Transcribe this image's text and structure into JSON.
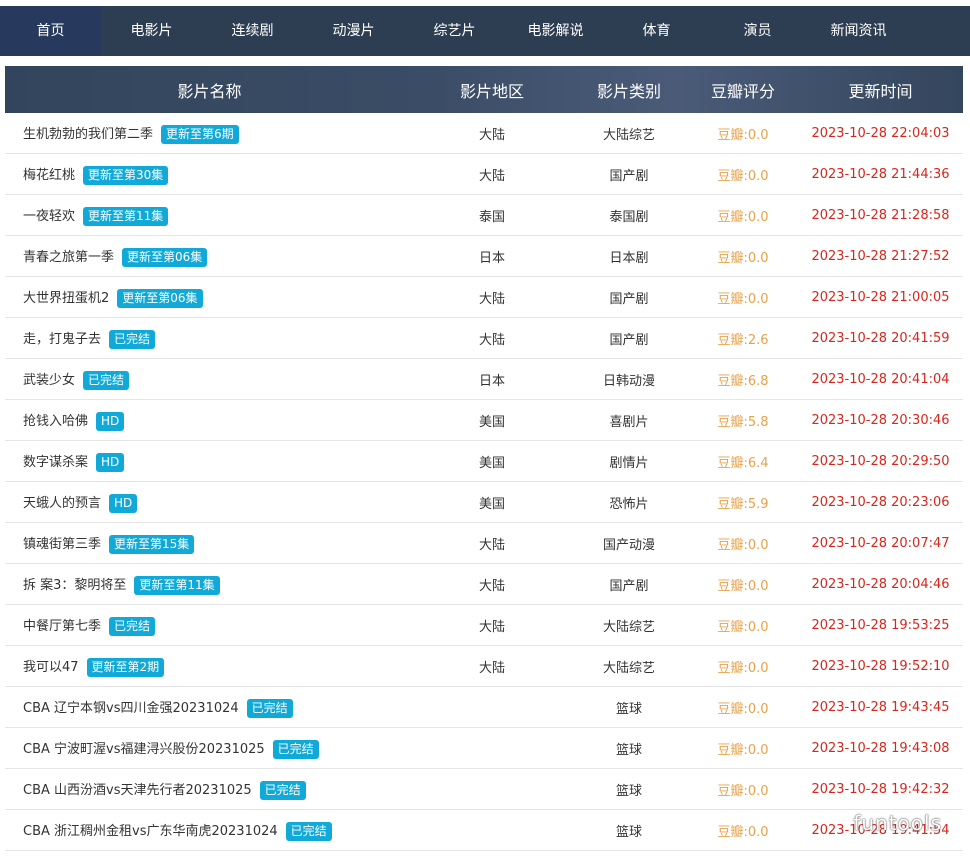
{
  "nav": [
    {
      "label": "首页",
      "active": true
    },
    {
      "label": "电影片"
    },
    {
      "label": "连续剧"
    },
    {
      "label": "动漫片"
    },
    {
      "label": "综艺片"
    },
    {
      "label": "电影解说"
    },
    {
      "label": "体育"
    },
    {
      "label": "演员"
    },
    {
      "label": "新闻资讯"
    }
  ],
  "table": {
    "headers": {
      "name": "影片名称",
      "region": "影片地区",
      "type": "影片类别",
      "score": "豆瓣评分",
      "time": "更新时间"
    },
    "rows": [
      {
        "title": "生机勃勃的我们第二季",
        "badge": "更新至第6期",
        "region": "大陆",
        "type": "大陆综艺",
        "score": "豆瓣:0.0",
        "time": "2023-10-28 22:04:03"
      },
      {
        "title": "梅花红桃",
        "badge": "更新至第30集",
        "region": "大陆",
        "type": "国产剧",
        "score": "豆瓣:0.0",
        "time": "2023-10-28 21:44:36"
      },
      {
        "title": "一夜轻欢",
        "badge": "更新至第11集",
        "region": "泰国",
        "type": "泰国剧",
        "score": "豆瓣:0.0",
        "time": "2023-10-28 21:28:58"
      },
      {
        "title": "青春之旅第一季",
        "badge": "更新至第06集",
        "region": "日本",
        "type": "日本剧",
        "score": "豆瓣:0.0",
        "time": "2023-10-28 21:27:52"
      },
      {
        "title": "大世界扭蛋机2",
        "badge": "更新至第06集",
        "region": "大陆",
        "type": "国产剧",
        "score": "豆瓣:0.0",
        "time": "2023-10-28 21:00:05"
      },
      {
        "title": "走，打鬼子去",
        "badge": "已完结",
        "region": "大陆",
        "type": "国产剧",
        "score": "豆瓣:2.6",
        "time": "2023-10-28 20:41:59"
      },
      {
        "title": "武装少女",
        "badge": "已完结",
        "region": "日本",
        "type": "日韩动漫",
        "score": "豆瓣:6.8",
        "time": "2023-10-28 20:41:04"
      },
      {
        "title": "抢钱入哈佛",
        "badge": "HD",
        "region": "美国",
        "type": "喜剧片",
        "score": "豆瓣:5.8",
        "time": "2023-10-28 20:30:46"
      },
      {
        "title": "数字谋杀案",
        "badge": "HD",
        "region": "美国",
        "type": "剧情片",
        "score": "豆瓣:6.4",
        "time": "2023-10-28 20:29:50"
      },
      {
        "title": "天蛾人的预言",
        "badge": "HD",
        "region": "美国",
        "type": "恐怖片",
        "score": "豆瓣:5.9",
        "time": "2023-10-28 20:23:06"
      },
      {
        "title": "镇魂街第三季",
        "badge": "更新至第15集",
        "region": "大陆",
        "type": "国产动漫",
        "score": "豆瓣:0.0",
        "time": "2023-10-28 20:07:47"
      },
      {
        "title": "拆 案3：黎明将至",
        "badge": "更新至第11集",
        "region": "大陆",
        "type": "国产剧",
        "score": "豆瓣:0.0",
        "time": "2023-10-28 20:04:46"
      },
      {
        "title": "中餐厅第七季",
        "badge": "已完结",
        "region": "大陆",
        "type": "大陆综艺",
        "score": "豆瓣:0.0",
        "time": "2023-10-28 19:53:25"
      },
      {
        "title": "我可以47",
        "badge": "更新至第2期",
        "region": "大陆",
        "type": "大陆综艺",
        "score": "豆瓣:0.0",
        "time": "2023-10-28 19:52:10"
      },
      {
        "title": "CBA 辽宁本钢vs四川金强20231024",
        "badge": "已完结",
        "region": "",
        "type": "篮球",
        "score": "豆瓣:0.0",
        "time": "2023-10-28 19:43:45"
      },
      {
        "title": "CBA 宁波町渥vs福建浔兴股份20231025",
        "badge": "已完结",
        "region": "",
        "type": "篮球",
        "score": "豆瓣:0.0",
        "time": "2023-10-28 19:43:08"
      },
      {
        "title": "CBA 山西汾酒vs天津先行者20231025",
        "badge": "已完结",
        "region": "",
        "type": "篮球",
        "score": "豆瓣:0.0",
        "time": "2023-10-28 19:42:32"
      },
      {
        "title": "CBA 浙江稠州金租vs广东华南虎20231024",
        "badge": "已完结",
        "region": "",
        "type": "篮球",
        "score": "豆瓣:0.0",
        "time": "2023-10-28 19:41:54"
      }
    ]
  },
  "watermark": "funtools",
  "colors": {
    "nav_bg": "#2e3e52",
    "nav_active": "#27395d",
    "badge": "#11a9d8",
    "score": "#e8a149",
    "time": "#d9261c"
  }
}
